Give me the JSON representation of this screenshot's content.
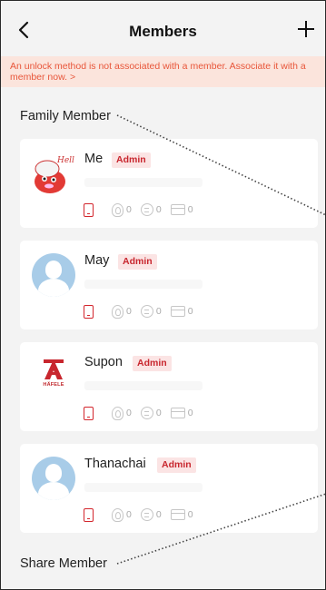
{
  "header": {
    "title": "Members",
    "back_icon": "chevron-left-icon",
    "add_icon": "plus-icon"
  },
  "banner": {
    "text": "An unlock method is not associated with a member. Associate it with a member now. >"
  },
  "sections": {
    "family_label": "Family Member",
    "share_label": "Share Member"
  },
  "members": [
    {
      "name": "Me",
      "badge": "Admin",
      "avatar": "cartoon-character-avatar",
      "methods": {
        "fingerprint": "0",
        "password": "0",
        "card": "0"
      }
    },
    {
      "name": "May",
      "badge": "Admin",
      "avatar": "default-person-avatar",
      "methods": {
        "fingerprint": "0",
        "password": "0",
        "card": "0"
      }
    },
    {
      "name": "Supon",
      "badge": "Admin",
      "avatar": "hafele-logo-avatar",
      "logo_text": "HÄFELE",
      "methods": {
        "fingerprint": "0",
        "password": "0",
        "card": "0"
      }
    },
    {
      "name": "Thanachai",
      "badge": "Admin",
      "avatar": "default-person-avatar",
      "methods": {
        "fingerprint": "0",
        "password": "0",
        "card": "0"
      }
    }
  ],
  "colors": {
    "accent_red": "#d3262d",
    "banner_bg": "#fbe4dc",
    "banner_text": "#e8563a",
    "background": "#f3f3f3",
    "avatar_blue": "#a8cce8"
  }
}
